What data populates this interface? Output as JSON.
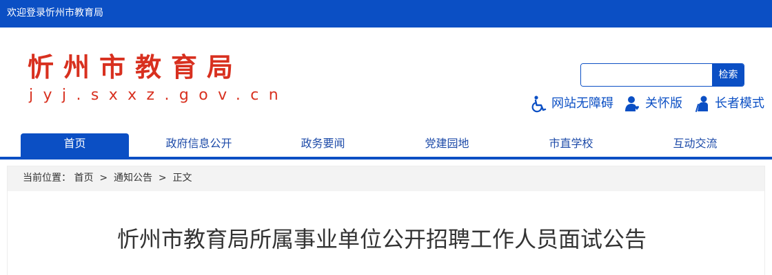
{
  "topbar": {
    "welcome": "欢迎登录忻州市教育局"
  },
  "logo": {
    "title": "忻州市教育局",
    "domain": "jyj.sxxz.gov.cn"
  },
  "search": {
    "placeholder": "",
    "value": "",
    "button_label": "检索"
  },
  "tools": [
    {
      "label": "网站无障碍",
      "icon": "wheelchair-icon"
    },
    {
      "label": "关怀版",
      "icon": "care-user-icon"
    },
    {
      "label": "长者模式",
      "icon": "elder-user-icon"
    }
  ],
  "nav": {
    "items": [
      {
        "label": "首页",
        "active": true
      },
      {
        "label": "政府信息公开"
      },
      {
        "label": "政务要闻"
      },
      {
        "label": "党建园地"
      },
      {
        "label": "市直学校"
      },
      {
        "label": "互动交流"
      }
    ]
  },
  "breadcrumb": {
    "prefix": "当前位置：",
    "items": [
      "首页",
      "通知公告",
      "正文"
    ],
    "separator": ">"
  },
  "article": {
    "title": "忻州市教育局所属事业单位公开招聘工作人员面试公告"
  },
  "colors": {
    "brand_blue": "#0b4fc4",
    "logo_red": "#d8301f",
    "crumb_bg": "#f3f3f3"
  }
}
